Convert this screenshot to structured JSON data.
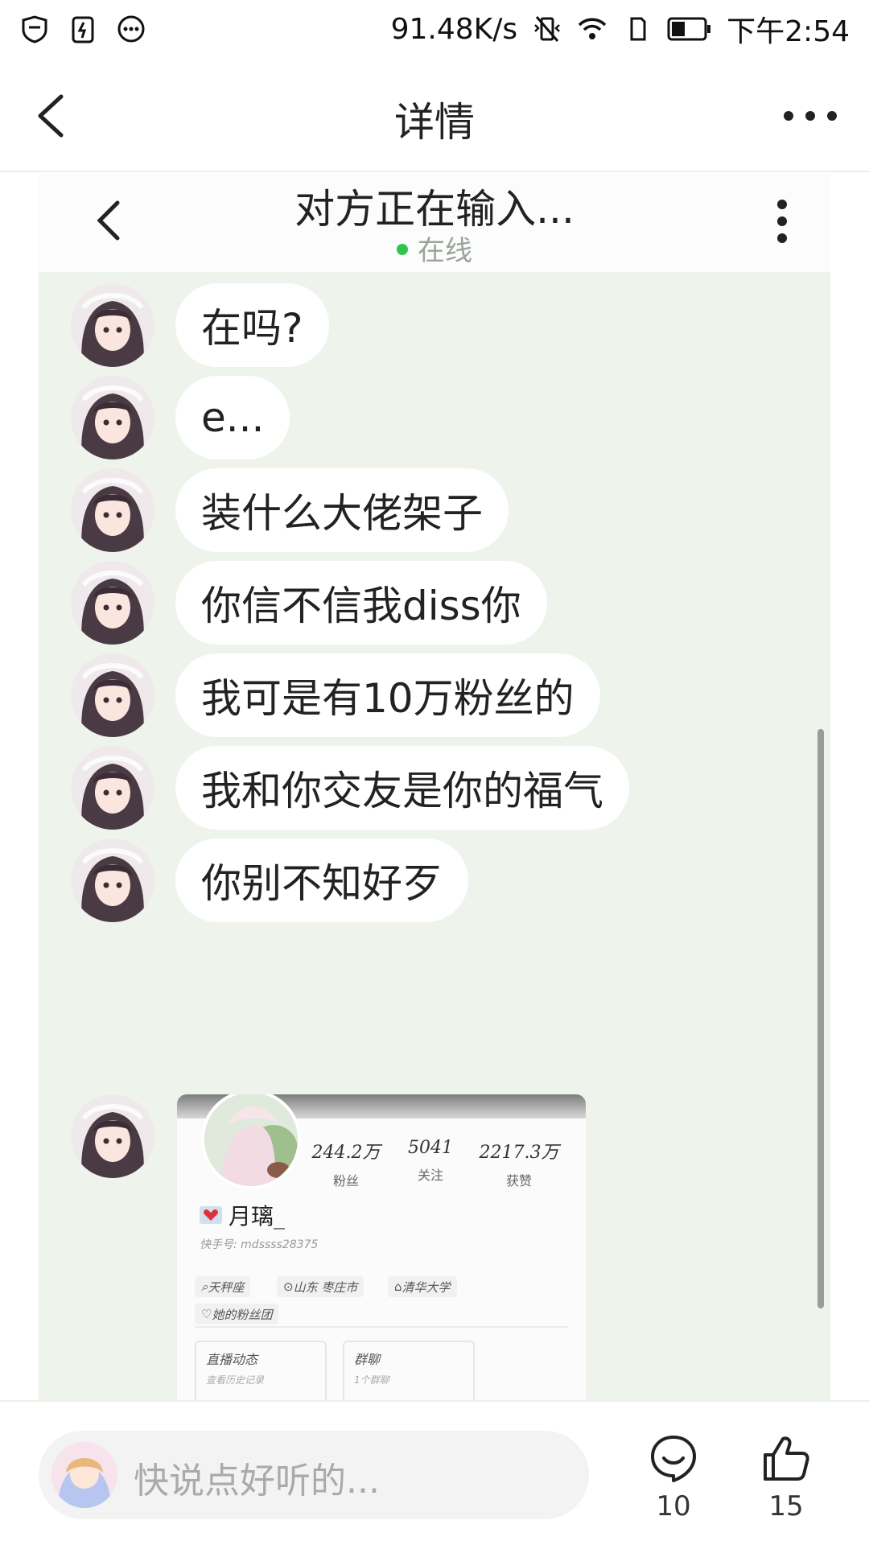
{
  "status_bar": {
    "net_speed": "91.48K/s",
    "time": "下午2:54"
  },
  "header": {
    "title": "详情"
  },
  "shot": {
    "chat_title": "对方正在输入...",
    "online": "在线",
    "messages": [
      "在吗?",
      "e...",
      "装什么大佬架子",
      "你信不信我diss你",
      "我可是有10万粉丝的",
      "我和你交友是你的福气",
      "你别不知好歹"
    ],
    "card": {
      "stats": [
        {
          "num": "244.2万",
          "label": "粉丝"
        },
        {
          "num": "5041",
          "label": "关注"
        },
        {
          "num": "2217.3万",
          "label": "获赞"
        }
      ],
      "name": "月璃_",
      "id": "快手号: mdssss28375",
      "tags": [
        "天秤座",
        "山东 枣庄市",
        "清华大学",
        "她的粉丝团"
      ],
      "sub_cards": [
        {
          "title": "直播动态",
          "sub": "查看历史记录"
        },
        {
          "title": "群聊",
          "sub": "1个群聊"
        }
      ]
    }
  },
  "bottom": {
    "placeholder": "快说点好听的...",
    "comment_count": "10",
    "like_count": "15"
  }
}
